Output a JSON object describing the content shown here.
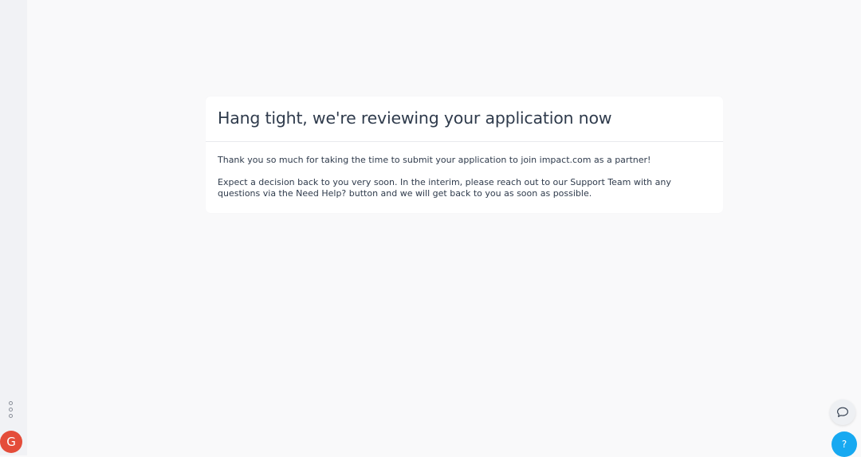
{
  "sidebar": {
    "more_icon": "vertical-dots-icon",
    "avatar_initial": "G",
    "avatar_color": "#e44d3a"
  },
  "card": {
    "title": "Hang tight, we're reviewing your application now",
    "paragraph_1": "Thank you so much for taking the time to submit your application to join impact.com as a partner!",
    "paragraph_2": "Expect a decision back to you very soon. In the interim, please reach out to our Support Team with any questions via the Need Help? button and we will get back to you as soon as possible."
  },
  "widgets": {
    "chat_icon": "chat-bubble-icon",
    "help_label": "?",
    "help_color": "#17a9f1"
  }
}
